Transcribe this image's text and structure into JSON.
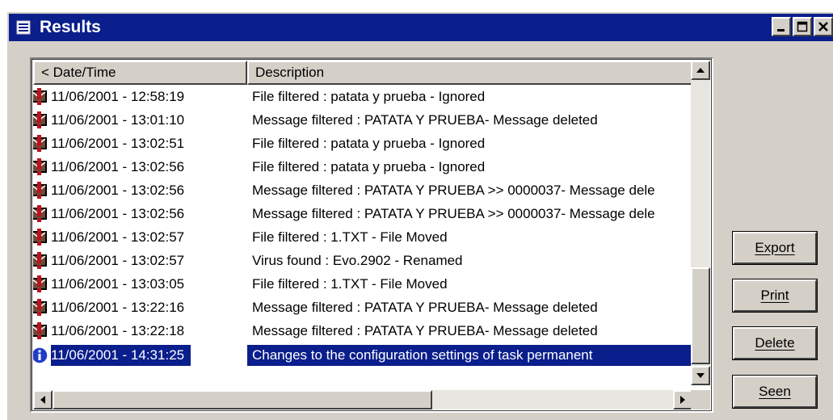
{
  "window": {
    "title": "Results"
  },
  "columns": [
    {
      "label": "< Date/Time"
    },
    {
      "label": "Description"
    }
  ],
  "rows": [
    {
      "icon": "filter-alert-icon",
      "datetime": "11/06/2001 - 12:58:19",
      "description": "File filtered :  patata y prueba - Ignored"
    },
    {
      "icon": "filter-alert-icon",
      "datetime": "11/06/2001 - 13:01:10",
      "description": "Message filtered :  PATATA Y PRUEBA- Message deleted"
    },
    {
      "icon": "filter-alert-icon",
      "datetime": "11/06/2001 - 13:02:51",
      "description": "File filtered :  patata y prueba - Ignored"
    },
    {
      "icon": "filter-alert-icon",
      "datetime": "11/06/2001 - 13:02:56",
      "description": "File filtered :  patata y prueba - Ignored"
    },
    {
      "icon": "filter-alert-icon",
      "datetime": "11/06/2001 - 13:02:56",
      "description": "Message filtered :  PATATA Y PRUEBA >> 0000037- Message dele"
    },
    {
      "icon": "filter-alert-icon",
      "datetime": "11/06/2001 - 13:02:56",
      "description": "Message filtered :  PATATA Y PRUEBA >> 0000037- Message dele"
    },
    {
      "icon": "filter-alert-icon",
      "datetime": "11/06/2001 - 13:02:57",
      "description": "File filtered :  1.TXT - File Moved"
    },
    {
      "icon": "filter-alert-icon",
      "datetime": "11/06/2001 - 13:02:57",
      "description": "Virus found :  Evo.2902 - Renamed"
    },
    {
      "icon": "filter-alert-icon",
      "datetime": "11/06/2001 - 13:03:05",
      "description": "File filtered :  1.TXT - File Moved"
    },
    {
      "icon": "filter-alert-icon",
      "datetime": "11/06/2001 - 13:22:16",
      "description": "Message filtered :  PATATA Y PRUEBA- Message deleted"
    },
    {
      "icon": "filter-alert-icon",
      "datetime": "11/06/2001 - 13:22:18",
      "description": "Message filtered :  PATATA Y PRUEBA- Message deleted"
    },
    {
      "icon": "info-icon",
      "datetime": "11/06/2001 - 14:31:25",
      "description": "Changes to the configuration settings of task permanent",
      "selected": true
    }
  ],
  "buttons": {
    "export": "Export",
    "print": "Print",
    "delete": "Delete",
    "seen": "Seen"
  },
  "colors": {
    "titlebar": "#0a1e8c",
    "selection": "#0a1e8c",
    "face": "#d4d0c8"
  }
}
